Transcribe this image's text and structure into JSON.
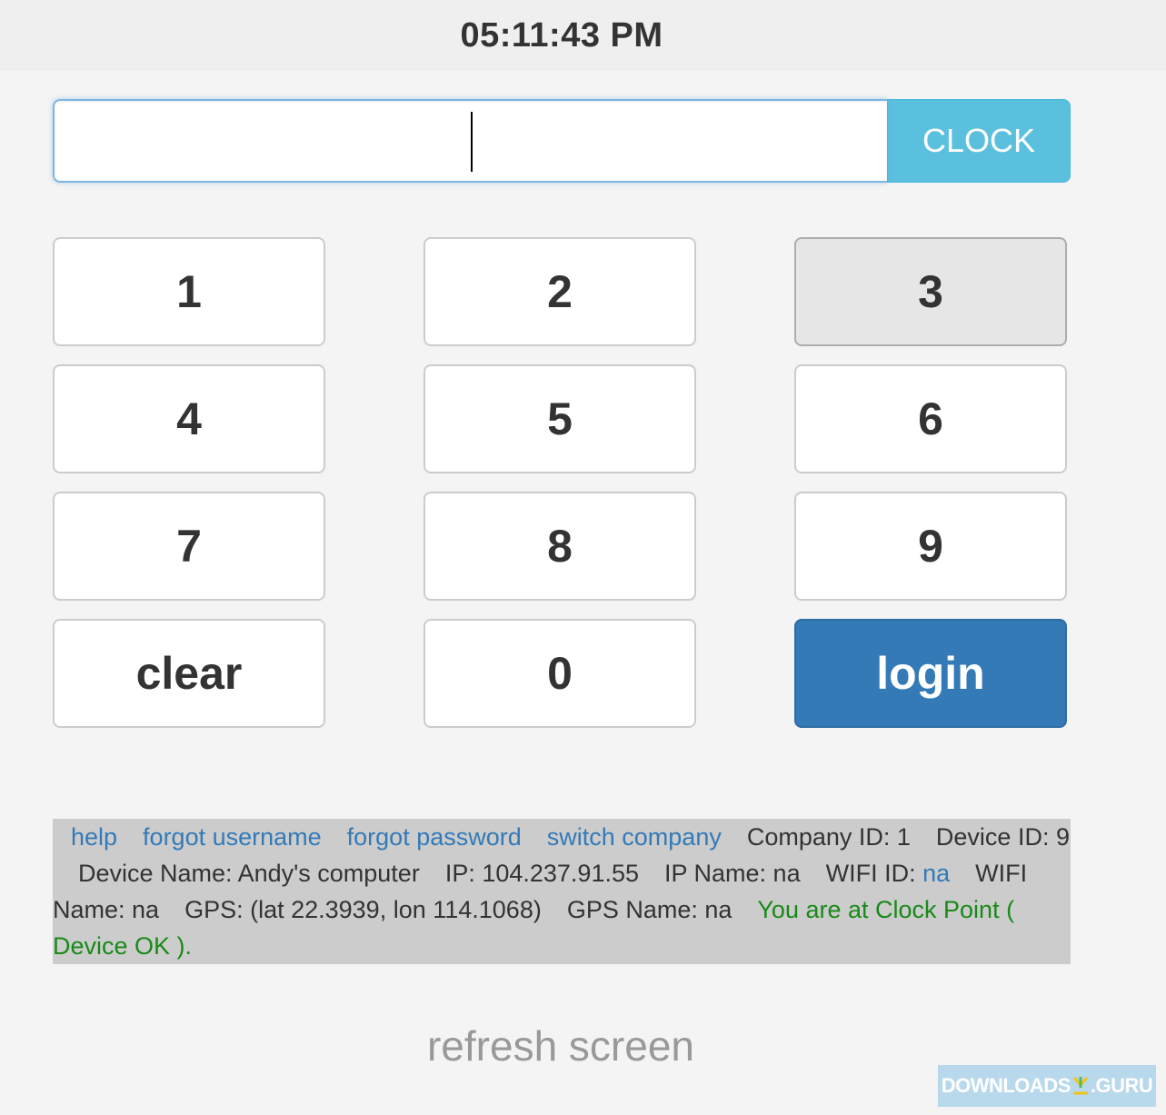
{
  "header": {
    "time": "05:11:43 PM"
  },
  "pin": {
    "value": "",
    "clock_label": "CLOCK"
  },
  "keypad": {
    "keys": [
      "1",
      "2",
      "3",
      "4",
      "5",
      "6",
      "7",
      "8",
      "9",
      "clear",
      "0",
      "login"
    ]
  },
  "info": {
    "links": {
      "help": "help",
      "forgot_username": "forgot username",
      "forgot_password": "forgot password",
      "switch_company": "switch company"
    },
    "company_id": "Company ID: 1",
    "device_id": "Device ID: 9",
    "device_name": "Device Name: Andy's computer",
    "ip": "IP: 104.237.91.55",
    "ip_name": "IP Name: na",
    "wifi_id_label": "WIFI ID:",
    "wifi_id_value": "na",
    "wifi_name": "WIFI Name: na",
    "gps": "GPS: (lat 22.3939, lon 114.1068)",
    "gps_name": "GPS Name: na",
    "status": "You are at Clock Point ( Device OK )."
  },
  "footer": {
    "refresh_label": "refresh screen"
  },
  "watermark": {
    "left": "DOWNLOADS",
    "right": ".GURU",
    "icon": "download-arrow-icon"
  },
  "colors": {
    "clock_button": "#5bc0de",
    "login_button": "#337ab7",
    "status_ok": "#188a18",
    "link": "#337ab7"
  }
}
